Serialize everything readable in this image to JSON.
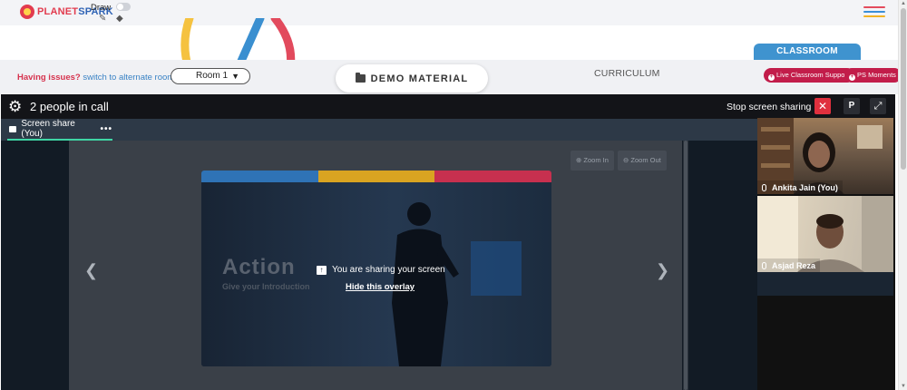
{
  "header": {
    "logo_part1": "PLANET",
    "logo_part2": "SPARK",
    "draw_label": "Draw",
    "draw_enabled": false,
    "menu_colors": [
      "#e34b5d",
      "#3b8fd8",
      "#f2b324"
    ]
  },
  "classroom": {
    "tab_label": "CLASSROOM",
    "issues_text": "Having issues?",
    "alternate_room_link": "switch to alternate room",
    "room_selected": "Room 1",
    "demo_material_label": "DEMO MATERIAL",
    "curriculum_label": "CURRICULUM",
    "live_support_label": "Live Classroom Support",
    "ps_moments_label": "PS Moments",
    "accent_color": "#3f93cf",
    "alert_color": "#c21d4a"
  },
  "call": {
    "people_count_label": "2 people in call",
    "stop_sharing_label": "Stop screen sharing",
    "p_button_label": "P",
    "tab_label": "Screen share (You)",
    "zoom_in_label": "Zoom In",
    "zoom_out_label": "Zoom Out",
    "slide_title": "Action",
    "slide_subtitle": "Give your Introduction",
    "slide_bar_colors": [
      "#2f73b6",
      "#d9a421",
      "#c7304f"
    ],
    "sharing_message": "You are sharing your screen",
    "hide_overlay_label": "Hide this overlay",
    "participants": [
      {
        "name": "Ankita Jain (You)"
      },
      {
        "name": "Asjad Reza"
      }
    ]
  }
}
